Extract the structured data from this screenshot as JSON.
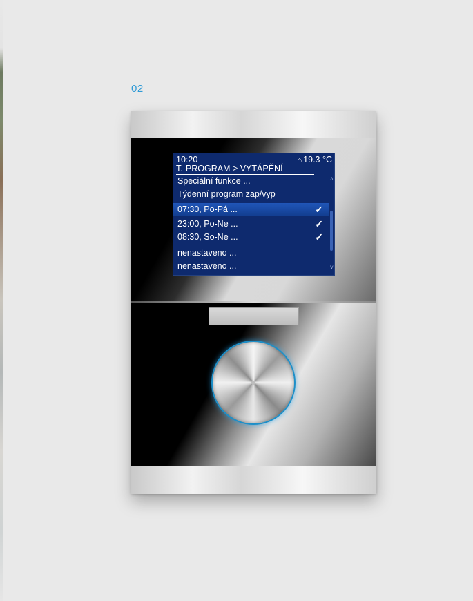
{
  "figure_label": "02",
  "screen": {
    "time": "10:20",
    "temperature": "19.3 °C",
    "breadcrumb": "T.-PROGRAM > VYTÁPĚNÍ",
    "scroll_up": "˄",
    "scroll_down": "˅",
    "items": [
      {
        "label": "Speciální funkce ...",
        "checked": false,
        "selected": false
      },
      {
        "label": "Týdenní program zap/vyp",
        "checked": false,
        "selected": false
      },
      {
        "label": "07:30, Po-Pá ...",
        "checked": true,
        "selected": true
      },
      {
        "label": "23:00, Po-Ne ...",
        "checked": true,
        "selected": false
      },
      {
        "label": "08:30, So-Ne ...",
        "checked": true,
        "selected": false
      },
      {
        "label": "nenastaveno ...",
        "checked": false,
        "selected": false
      },
      {
        "label": "nenastaveno ...",
        "checked": false,
        "selected": false
      }
    ],
    "check_glyph": "✓",
    "home_icon": "house-icon"
  },
  "colors": {
    "accent": "#2f9ad6",
    "screen_bg": "#0e2a6e",
    "selection": "#1a4aa6",
    "knob_ring": "#1d8fc8"
  }
}
